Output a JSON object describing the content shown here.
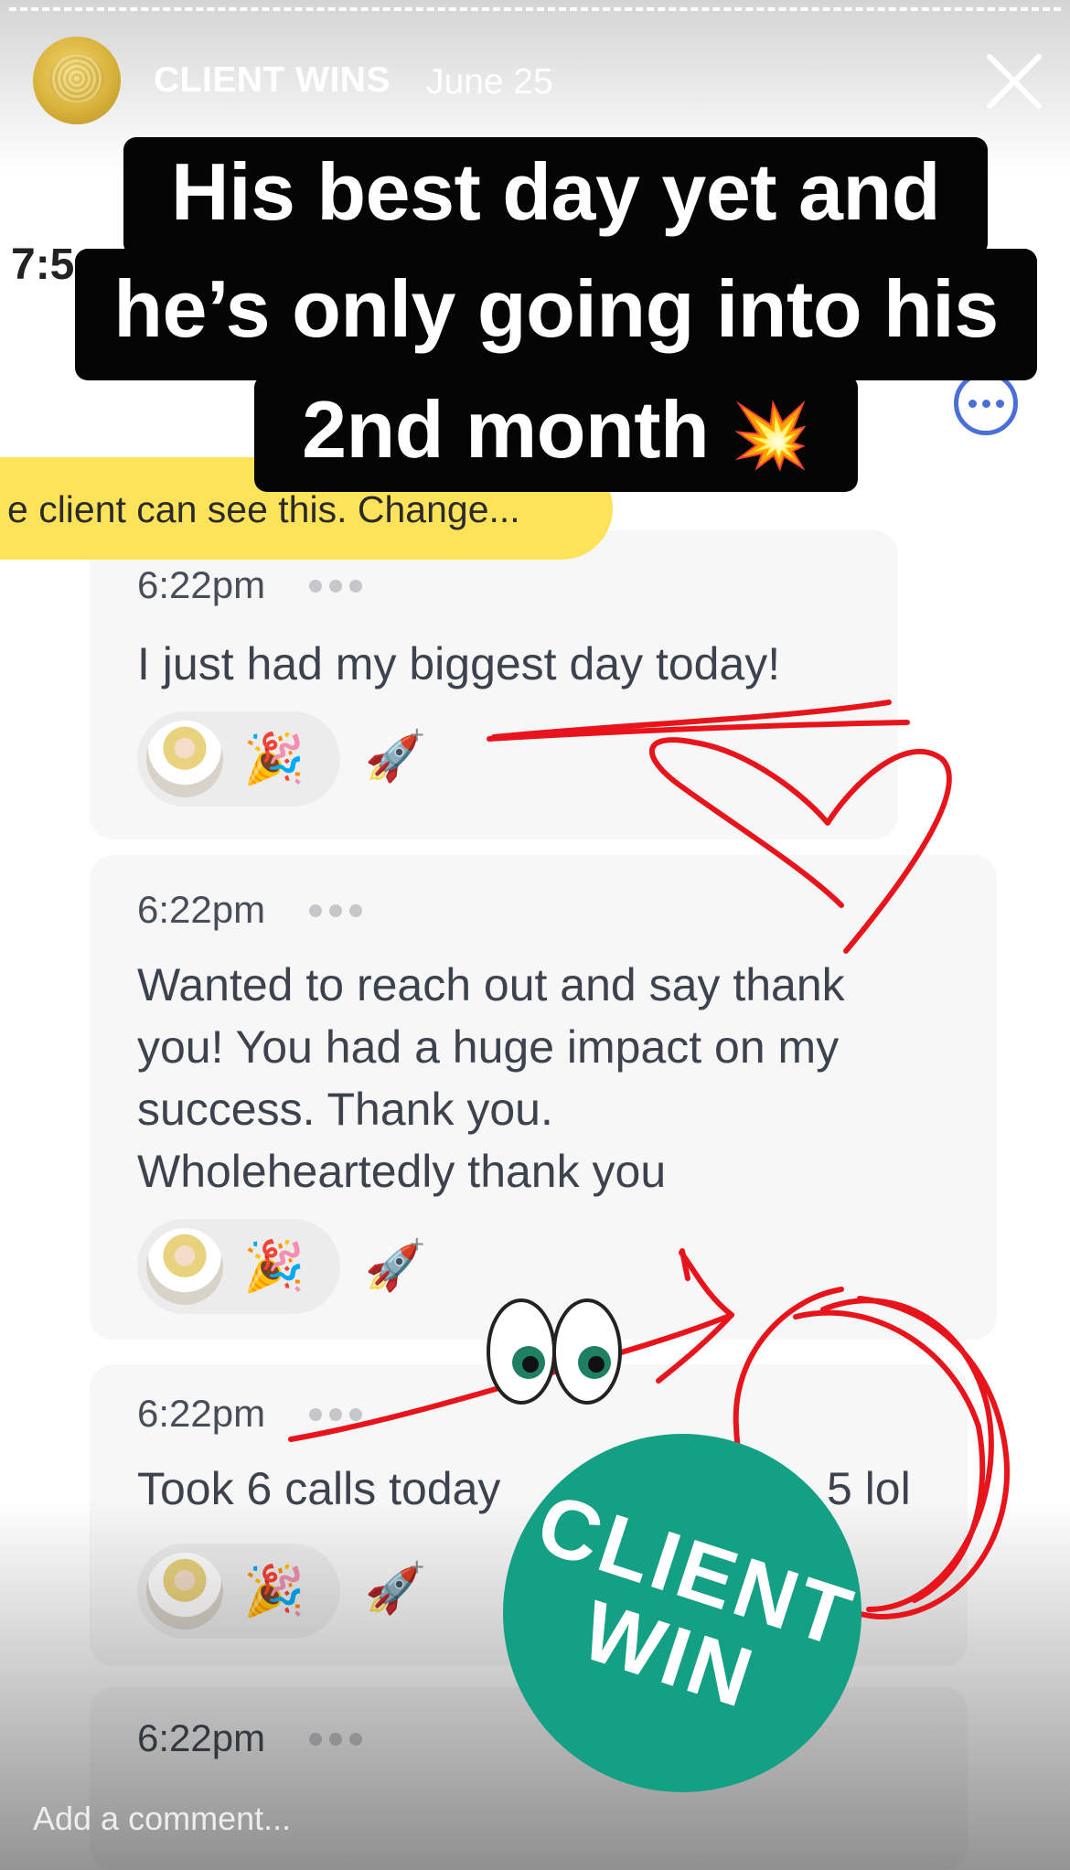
{
  "story_header": {
    "account_name": "CLIENT WINS",
    "date": "June 25",
    "close_icon": "close-icon"
  },
  "background_app": {
    "status_time": "7:5",
    "more_icon": "more-options-icon",
    "visibility_banner": "e client can see this. Change..."
  },
  "caption": {
    "line1": "His best day yet and",
    "line2": "he’s only going into his",
    "line3": "2nd month",
    "sticker_emoji": "💥"
  },
  "messages": [
    {
      "time": "6:22pm",
      "lines": [
        "I just had my biggest day today!"
      ],
      "reaction_emoji": "🎉"
    },
    {
      "time": "6:22pm",
      "lines": [
        "Wanted to reach out and say thank",
        "you! You had a huge impact on my",
        "success. Thank you.",
        "Wholeheartedly thank you"
      ],
      "reaction_emoji": "🎉"
    },
    {
      "time": "6:22pm",
      "lines": [
        "Took 6 calls today",
        "5 lol"
      ],
      "reaction_emoji": "🎉"
    },
    {
      "time": "6:22pm"
    }
  ],
  "add_reaction_icon": "🚀",
  "badge": {
    "text": "CLIENT\nWIN",
    "color": "#14a085"
  },
  "annotation_color": "#e8141c",
  "footer": {
    "comment_placeholder": "Add a comment..."
  }
}
